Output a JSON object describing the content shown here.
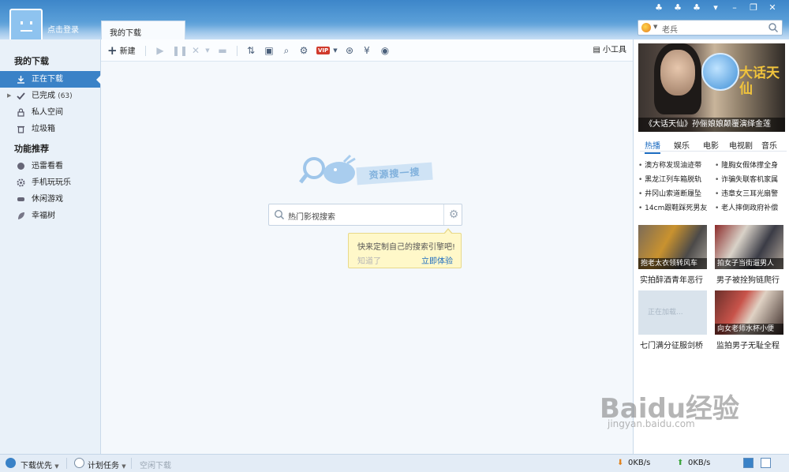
{
  "header": {
    "login_text": "点击登录",
    "active_tab": "我的下载",
    "top_search_value": "老兵"
  },
  "sidebar": {
    "section1_title": "我的下载",
    "items": [
      {
        "label": "正在下载",
        "icon": "download-icon"
      },
      {
        "label": "已完成",
        "count": "(63)",
        "icon": "checkmark-icon"
      },
      {
        "label": "私人空间",
        "icon": "lock-icon"
      },
      {
        "label": "垃圾箱",
        "icon": "trash-icon"
      }
    ],
    "section2_title": "功能推荐",
    "features": [
      {
        "label": "迅雷看看",
        "icon": "heart-icon"
      },
      {
        "label": "手机玩玩乐",
        "icon": "gear-icon"
      },
      {
        "label": "休闲游戏",
        "icon": "gamepad-icon"
      },
      {
        "label": "幸福树",
        "icon": "leaf-icon"
      }
    ]
  },
  "toolbar": {
    "new_label": "新建",
    "vip_label": "VIP",
    "tools_label": "小工具"
  },
  "main": {
    "mascot_text": "资源搜一搜",
    "search_placeholder": "热门影视搜索",
    "tooltip_message": "快来定制自己的搜索引擎吧!",
    "tooltip_dismiss": "知道了",
    "tooltip_action": "立即体验"
  },
  "right_panel": {
    "banner_brand": "大话天仙",
    "banner_caption": "《大话天仙》孙俪娘娘颠覆演绎金莲",
    "tabs": [
      "热播",
      "娱乐",
      "电影",
      "电视剧",
      "音乐"
    ],
    "news_left": [
      "澳方称发现油迹带",
      "黑龙江列车箱脱轨",
      "井冈山索道断履坠",
      "14cm跟鞋踩死男友"
    ],
    "news_right": [
      "隆胸女假体撑全身",
      "诈骗失联客机家属",
      "违章女三耳光扇警",
      "老人摔倒政府补偿"
    ],
    "thumbs": [
      {
        "caption": "抱老太衣领转风车",
        "label": "实拍醉酒青年恶行"
      },
      {
        "caption": "拍女子当街遛男人",
        "label": "男子被拴狗链爬行"
      },
      {
        "caption": "",
        "label": "七门满分征服剑桥",
        "loading": "正在加载..."
      },
      {
        "caption": "向女老师水杯小便",
        "label": "监拍男子无耻全程"
      }
    ]
  },
  "statusbar": {
    "priority_label": "下载优先",
    "schedule_label": "计划任务",
    "idle_label": "空闲下载",
    "down_speed": "0KB/s",
    "up_speed": "0KB/s"
  },
  "watermark": {
    "brand": "Baidu经验",
    "url": "jingyan.baidu.com"
  },
  "colors": {
    "accent": "#3a82c7",
    "header": "#5a9fd8",
    "link": "#1b6bc0"
  }
}
